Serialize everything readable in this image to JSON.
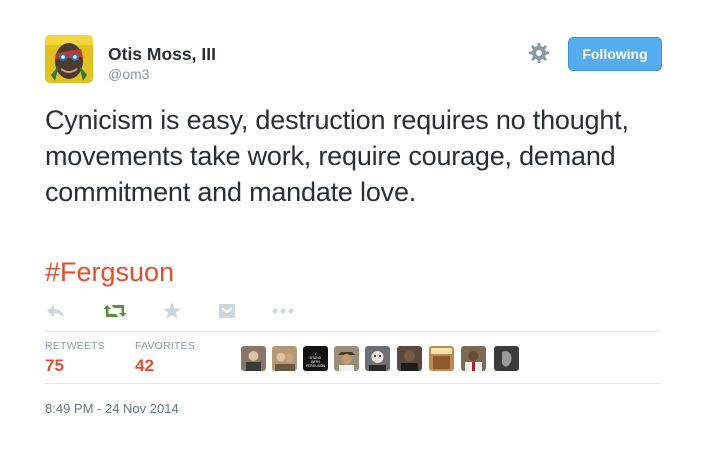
{
  "user": {
    "name": "Otis Moss, III",
    "handle": "@om3",
    "avatar_icon": "profile-avatar"
  },
  "follow_button": {
    "label": "Following",
    "color": "#55acee"
  },
  "settings_icon": "gear-icon",
  "tweet": {
    "text": "Cynicism is easy, destruction requires no thought, movements take work, require courage, demand commitment and mandate love.",
    "hashtag": "#Fergsuon",
    "hashtag_color": "#e74d2c"
  },
  "actions": [
    {
      "icon": "reply-icon"
    },
    {
      "icon": "retweet-icon",
      "color": "#5c913b"
    },
    {
      "icon": "favorite-star-icon"
    },
    {
      "icon": "embed-icon"
    },
    {
      "icon": "more-options-icon"
    }
  ],
  "stats": {
    "retweets_label": "RETWEETS",
    "retweets_count": "75",
    "favorites_label": "FAVORITES",
    "favorites_count": "42"
  },
  "favorited_by": [
    {
      "icon": "user-avatar",
      "color": "#8a7866"
    },
    {
      "icon": "user-avatar",
      "color": "#b39a76"
    },
    {
      "icon": "user-avatar",
      "text": "I STAND WITH FERGUSON",
      "color": "#111111"
    },
    {
      "icon": "user-avatar",
      "color": "#9b8f7a"
    },
    {
      "icon": "user-avatar",
      "color": "#6d6f72"
    },
    {
      "icon": "user-avatar",
      "color": "#5a4a3e"
    },
    {
      "icon": "user-avatar",
      "color": "#c08a4a"
    },
    {
      "icon": "user-avatar",
      "color": "#7a6a55"
    },
    {
      "icon": "user-avatar",
      "color": "#3a3a3a"
    }
  ],
  "timestamp": "8:49 PM - 24 Nov 2014"
}
